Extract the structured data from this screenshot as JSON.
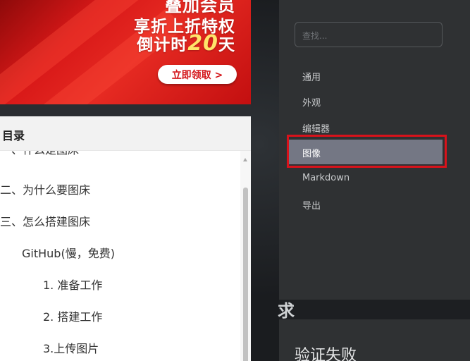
{
  "ad": {
    "line1": "叠加会员",
    "line2": "享折上折特权",
    "line3_prefix": "倒计时",
    "line3_count": "20",
    "line3_suffix": "天",
    "button_label": "立即领取 >"
  },
  "toc": {
    "title": "目录",
    "items": [
      "一、什么是图床",
      "二、为什么要图床",
      "三、怎么搭建图床",
      "GitHub(慢，免费)",
      "1. 准备工作",
      "2. 搭建工作",
      "3.上传图片"
    ]
  },
  "settings": {
    "search_placeholder": "查找...",
    "nav": [
      "通用",
      "外观",
      "编辑器",
      "图像",
      "Markdown",
      "导出"
    ],
    "active_index": 3
  },
  "dialog": {
    "partial_text": "求",
    "title": "验证失败"
  },
  "colors": {
    "ad_red": "#d81818",
    "highlight_outline": "#d8121b",
    "nav_active_bg": "#747784",
    "panel_bg": "#2f3133"
  }
}
